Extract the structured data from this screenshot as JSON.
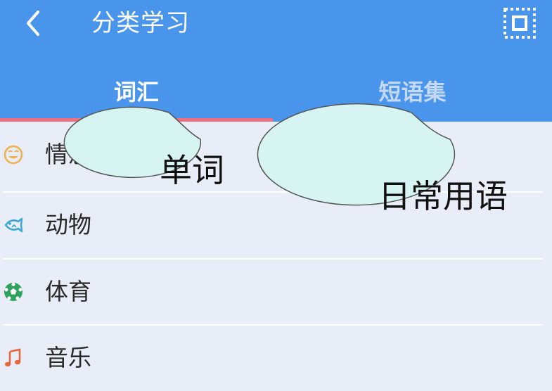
{
  "header": {
    "title": "分类学习",
    "back_icon": "chevron-left-icon",
    "scan_icon": "scan-frame-icon",
    "background_color": "#4995ec"
  },
  "tabs": [
    {
      "label": "词汇",
      "active": true
    },
    {
      "label": "短语集",
      "active": false
    }
  ],
  "tab_indicator_color": "#ef6f7e",
  "categories": [
    {
      "label": "情感",
      "icon": "smiley-face-icon",
      "icon_color": "#f0b04a"
    },
    {
      "label": "动物",
      "icon": "fish-icon",
      "icon_color": "#3aa6d8"
    },
    {
      "label": "体育",
      "icon": "soccer-ball-icon",
      "icon_color": "#2fa35a"
    },
    {
      "label": "音乐",
      "icon": "music-note-icon",
      "icon_color": "#e8673a"
    }
  ],
  "callouts": {
    "word": "单词",
    "phrase": "日常用语",
    "fill_color": "#d6f5f2"
  }
}
